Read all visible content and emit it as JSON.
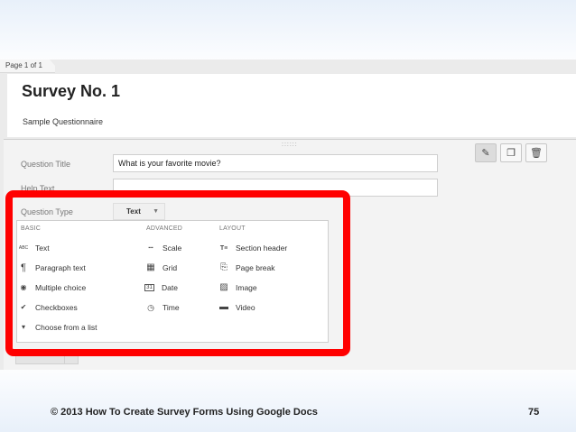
{
  "page_label": "Page 1 of 1",
  "form": {
    "title": "Survey No. 1",
    "description": "Sample Questionnaire"
  },
  "question": {
    "title_label": "Question Title",
    "title_value": "What is your favorite movie?",
    "help_label": "Help Text",
    "type_label": "Question Type",
    "type_value": "Text",
    "drag_handle": "::::::",
    "toolbar": {
      "edit_icon": "pencil-icon",
      "duplicate_icon": "duplicate-icon",
      "delete_icon": "trash-icon"
    }
  },
  "dropdown": {
    "basic": {
      "heading": "BASIC",
      "items": [
        {
          "label": "Text",
          "icon": "ABC"
        },
        {
          "label": "Paragraph text",
          "icon": "¶"
        },
        {
          "label": "Multiple choice",
          "icon": "◉"
        },
        {
          "label": "Checkboxes",
          "icon": "✔"
        },
        {
          "label": "Choose from a list",
          "icon": "▾"
        }
      ]
    },
    "advanced": {
      "heading": "ADVANCED",
      "items": [
        {
          "label": "Scale",
          "icon": "▪▪▪"
        },
        {
          "label": "Grid",
          "icon": "▦"
        },
        {
          "label": "Date",
          "icon": "31"
        },
        {
          "label": "Time",
          "icon": "◷"
        }
      ]
    },
    "layout": {
      "heading": "LAYOUT",
      "items": [
        {
          "label": "Section header",
          "icon": "T≡"
        },
        {
          "label": "Page break",
          "icon": "⎘"
        },
        {
          "label": "Image",
          "icon": "▨"
        },
        {
          "label": "Video",
          "icon": "▬"
        }
      ]
    }
  },
  "footer": {
    "text": "© 2013 How To Create Survey Forms Using Google Docs",
    "page_number": "75"
  },
  "colors": {
    "highlight": "#ff0000"
  }
}
